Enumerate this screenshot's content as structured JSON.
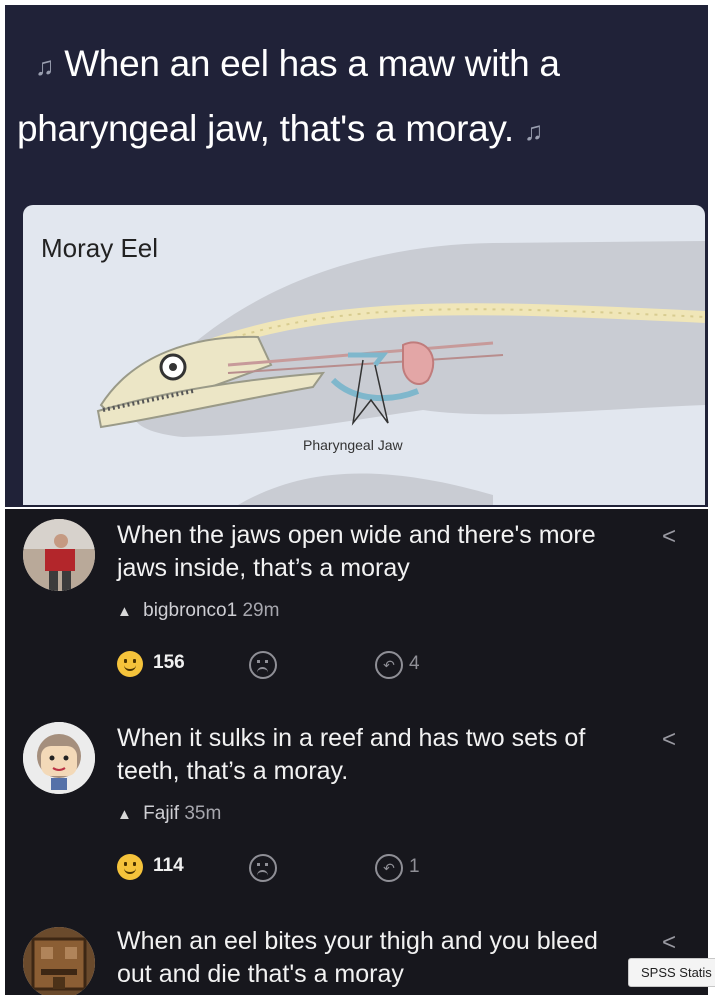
{
  "headline": {
    "line1": "When an eel has a maw with a",
    "line2": "pharyngeal jaw, that's a moray.",
    "note_glyph": "♫"
  },
  "diagram": {
    "title": "Moray Eel",
    "label": "Pharyngeal Jaw"
  },
  "comments": [
    {
      "text": "When the jaws open wide and there's more jaws inside, that’s a moray",
      "user": "bigbronco1",
      "time": "29m",
      "reactions": "156",
      "replies": "4",
      "avatar": "man-in-red-shirt"
    },
    {
      "text": "When it sulks in a reef and has two sets of teeth, that’s a moray.",
      "user": "Fajif",
      "time": "35m",
      "reactions": "114",
      "replies": "1",
      "avatar": "cartoon-face"
    },
    {
      "text": "When an eel bites your thigh and you bleed out and die that's a moray",
      "user": "",
      "time": "",
      "reactions": "",
      "replies": "",
      "avatar": "crafting-table"
    }
  ],
  "tooltip": "SPSS Statis",
  "icons": {
    "reply": "reply-arrow-icon",
    "reaction": "smile-icon",
    "dislike": "frown-icon",
    "replies": "replies-icon",
    "flame": "flame-icon"
  },
  "colors": {
    "headline_bg": "#202238",
    "comments_bg": "#17171d",
    "reaction": "#f5c33b"
  }
}
